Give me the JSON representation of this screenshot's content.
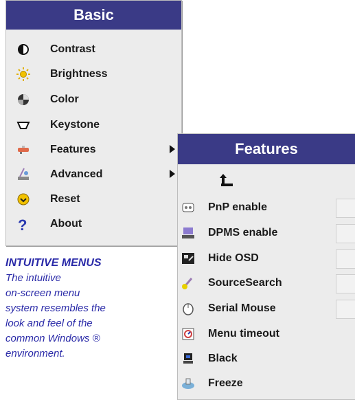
{
  "basic_menu": {
    "title": "Basic",
    "items": [
      {
        "label": "Contrast",
        "icon": "contrast-icon"
      },
      {
        "label": "Brightness",
        "icon": "brightness-icon"
      },
      {
        "label": "Color",
        "icon": "color-icon"
      },
      {
        "label": "Keystone",
        "icon": "keystone-icon"
      },
      {
        "label": "Features",
        "icon": "features-icon",
        "submenu": true
      },
      {
        "label": "Advanced",
        "icon": "advanced-icon",
        "submenu": true
      },
      {
        "label": "Reset",
        "icon": "reset-icon"
      },
      {
        "label": "About",
        "icon": "about-icon"
      }
    ]
  },
  "features_menu": {
    "title": "Features",
    "back_icon": "back-arrow-icon",
    "items": [
      {
        "label": "PnP enable",
        "icon": "pnp-icon",
        "has_checkbox": true
      },
      {
        "label": "DPMS enable",
        "icon": "dpms-icon",
        "has_checkbox": true
      },
      {
        "label": "Hide OSD",
        "icon": "hide-osd-icon",
        "has_checkbox": true
      },
      {
        "label": "SourceSearch",
        "icon": "source-search-icon",
        "has_checkbox": true
      },
      {
        "label": "Serial Mouse",
        "icon": "mouse-icon",
        "has_checkbox": true
      },
      {
        "label": "Menu timeout",
        "icon": "menu-timeout-icon"
      },
      {
        "label": "Black",
        "icon": "black-icon"
      },
      {
        "label": "Freeze",
        "icon": "freeze-icon"
      }
    ]
  },
  "caption": {
    "heading": "INTUITIVE MENUS",
    "lines": [
      "The intuitive",
      "on-screen menu",
      "system resembles the",
      "look and feel of the",
      "common Windows ®",
      "environment."
    ]
  },
  "colors": {
    "header_bg": "#3a3a86",
    "menu_bg": "#ececec",
    "caption_text": "#2a2aa8"
  }
}
